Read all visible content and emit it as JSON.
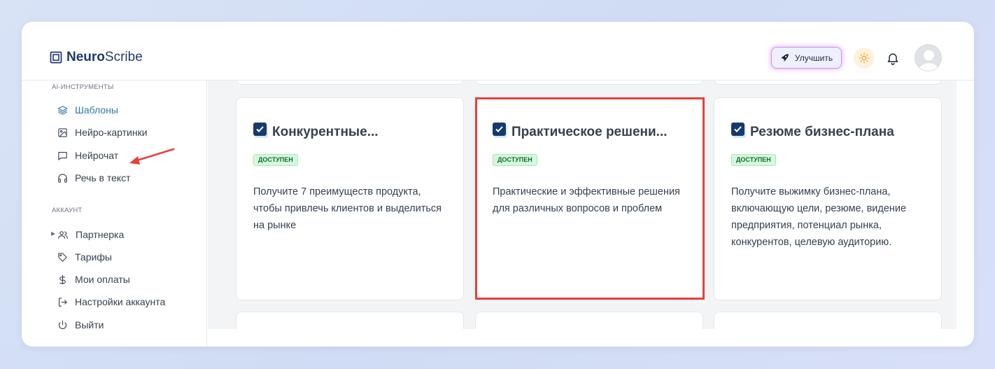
{
  "app": {
    "logo_bold": "Neuro",
    "logo_light": "Scribe"
  },
  "header": {
    "upgrade_label": "Улучшить"
  },
  "sidebar": {
    "section_ai": "AI-ИНСТРУМЕНТЫ",
    "ai_items": [
      {
        "label": "Шаблоны",
        "icon": "layers-icon"
      },
      {
        "label": "Нейро-картинки",
        "icon": "image-icon"
      },
      {
        "label": "Нейрочат",
        "icon": "chat-icon"
      },
      {
        "label": "Речь в текст",
        "icon": "headphones-icon"
      }
    ],
    "section_account": "АККАУНТ",
    "account_items": [
      {
        "label": "Партнерка",
        "icon": "users-icon"
      },
      {
        "label": "Тарифы",
        "icon": "tag-icon"
      },
      {
        "label": "Мои оплаты",
        "icon": "dollar-icon"
      },
      {
        "label": "Настройки аккаунта",
        "icon": "login-icon"
      },
      {
        "label": "Выйти",
        "icon": "power-icon"
      }
    ]
  },
  "cards": [
    {
      "title": "Конкурентные...",
      "badge": "ДОСТУПЕН",
      "description": "Получите 7 преимуществ продукта, чтобы привлечь клиентов и выделиться на рынке"
    },
    {
      "title": "Практическое решени...",
      "badge": "ДОСТУПЕН",
      "description": "Практические и эффективные решения для различных вопросов и проблем"
    },
    {
      "title": "Резюме бизнес-плана",
      "badge": "ДОСТУПЕН",
      "description": "Получите выжимку бизнес-плана, включающую цели, резюме, видение предприятия, потенциал рынка, конкурентов, целевую аудиторию."
    }
  ],
  "colors": {
    "accent_active": "#2d7aa8",
    "badge_bg": "#d6f8dc",
    "highlight_border": "#e8403a",
    "annotation_arrow": "#e8403a"
  }
}
